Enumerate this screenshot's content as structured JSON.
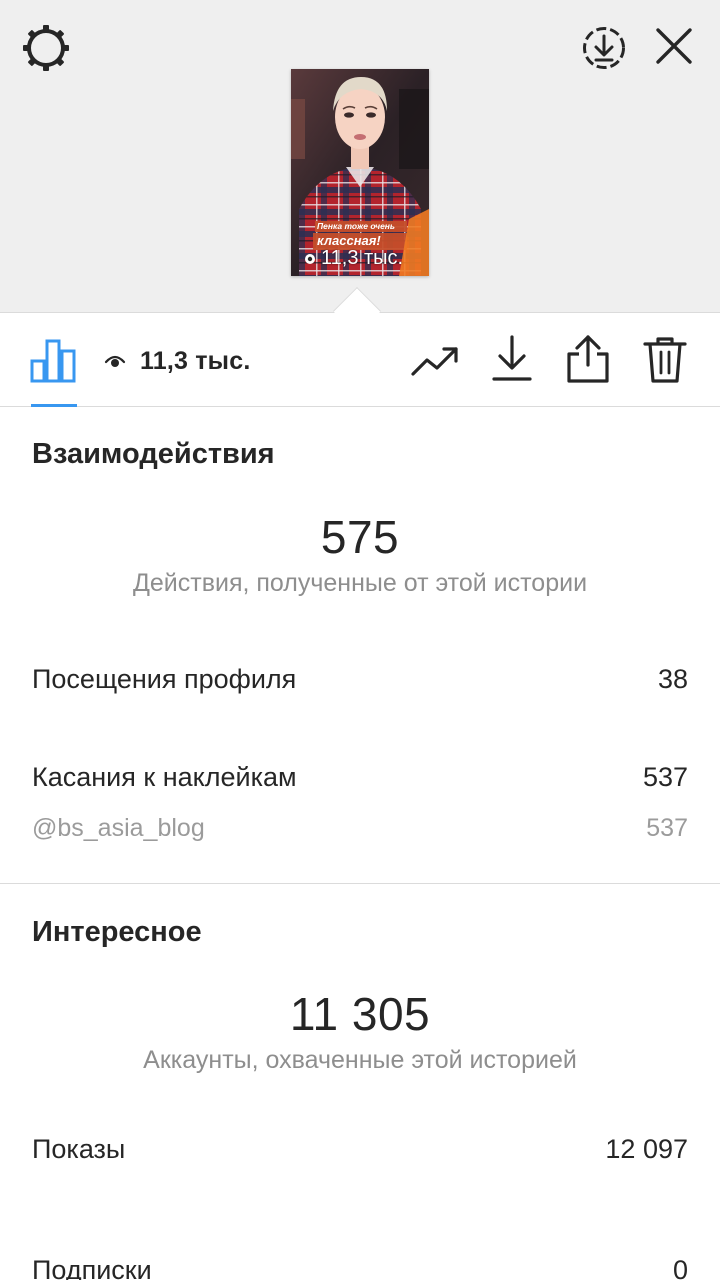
{
  "story": {
    "caption_line1": "Пенка тоже очень",
    "caption_line2": "классная!",
    "views_overlay": "11,3 тыс."
  },
  "toolbar": {
    "views": "11,3 тыс."
  },
  "interactions": {
    "title": "Взаимодействия",
    "total": "575",
    "caption": "Действия, полученные от этой истории",
    "rows": [
      {
        "label": "Посещения профиля",
        "value": "38"
      },
      {
        "label": "Касания к наклейкам",
        "value": "537"
      }
    ],
    "sub_row": {
      "label": "@bs_asia_blog",
      "value": "537"
    }
  },
  "discovery": {
    "title": "Интересное",
    "total": "11 305",
    "caption": "Аккаунты, охваченные этой историей",
    "rows": [
      {
        "label": "Показы",
        "value": "12 097"
      },
      {
        "label": "Подписки",
        "value": "0"
      }
    ]
  },
  "icons": {
    "settings": "gear-icon",
    "download_circle": "download-circle-icon",
    "close": "close-icon",
    "insights": "bar-chart-icon",
    "views": "eye-icon",
    "promote": "trend-icon",
    "save": "download-icon",
    "share": "share-icon",
    "delete": "trash-icon"
  },
  "colors": {
    "accent": "#3897f0",
    "text": "#262626",
    "muted": "#8e8e8e",
    "top_bg": "#efefef"
  }
}
